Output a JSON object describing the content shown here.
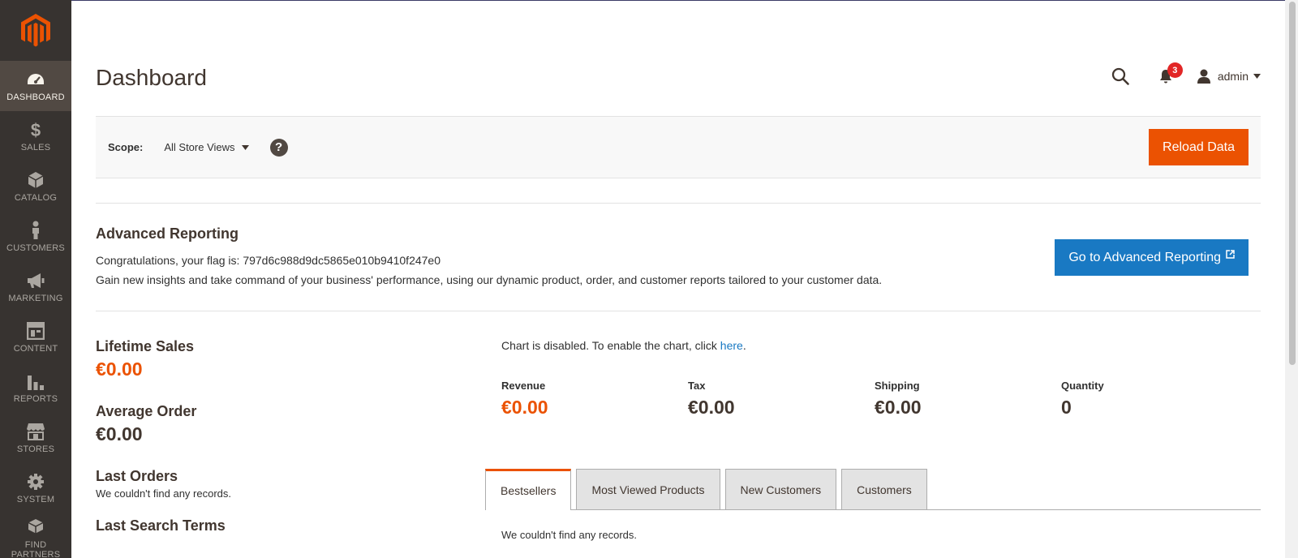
{
  "colors": {
    "accent": "#eb5202",
    "link": "#1979c3",
    "sidebar": "#373330"
  },
  "sidebar": {
    "logo": "magento-logo",
    "items": [
      {
        "label": "DASHBOARD",
        "icon": "dashboard-gauge-icon",
        "active": true
      },
      {
        "label": "SALES",
        "icon": "dollar-icon"
      },
      {
        "label": "CATALOG",
        "icon": "cube-icon"
      },
      {
        "label": "CUSTOMERS",
        "icon": "person-icon"
      },
      {
        "label": "MARKETING",
        "icon": "megaphone-icon"
      },
      {
        "label": "CONTENT",
        "icon": "layout-icon"
      },
      {
        "label": "REPORTS",
        "icon": "bar-chart-icon"
      },
      {
        "label": "STORES",
        "icon": "storefront-icon"
      },
      {
        "label": "SYSTEM",
        "icon": "gear-icon"
      },
      {
        "label": "FIND PARTNERS",
        "icon": "boxes-icon"
      }
    ]
  },
  "header": {
    "title": "Dashboard",
    "notifications_count": "3",
    "user_name": "admin"
  },
  "scope": {
    "label": "Scope:",
    "value": "All Store Views",
    "help": "?",
    "reload_label": "Reload Data"
  },
  "advanced_reporting": {
    "title": "Advanced Reporting",
    "flag_text": "Congratulations, your flag is: 797d6c988d9dc5865e010b9410f247e0",
    "description": "Gain new insights and take command of your business' performance, using our dynamic product, order, and customer reports tailored to your customer data.",
    "button_label": "Go to Advanced Reporting"
  },
  "stats": {
    "lifetime_sales": {
      "label": "Lifetime Sales",
      "value": "€0.00"
    },
    "average_order": {
      "label": "Average Order",
      "value": "€0.00"
    },
    "last_orders": {
      "label": "Last Orders",
      "empty": "We couldn't find any records."
    },
    "last_search_terms": {
      "label": "Last Search Terms"
    }
  },
  "chart": {
    "disabled_text": "Chart is disabled. To enable the chart, click ",
    "link_text": "here",
    "suffix": "."
  },
  "totals": [
    {
      "label": "Revenue",
      "value": "€0.00"
    },
    {
      "label": "Tax",
      "value": "€0.00"
    },
    {
      "label": "Shipping",
      "value": "€0.00"
    },
    {
      "label": "Quantity",
      "value": "0"
    }
  ],
  "tabs": [
    {
      "label": "Bestsellers",
      "active": true
    },
    {
      "label": "Most Viewed Products"
    },
    {
      "label": "New Customers"
    },
    {
      "label": "Customers"
    }
  ],
  "tab_content": {
    "empty": "We couldn't find any records."
  }
}
